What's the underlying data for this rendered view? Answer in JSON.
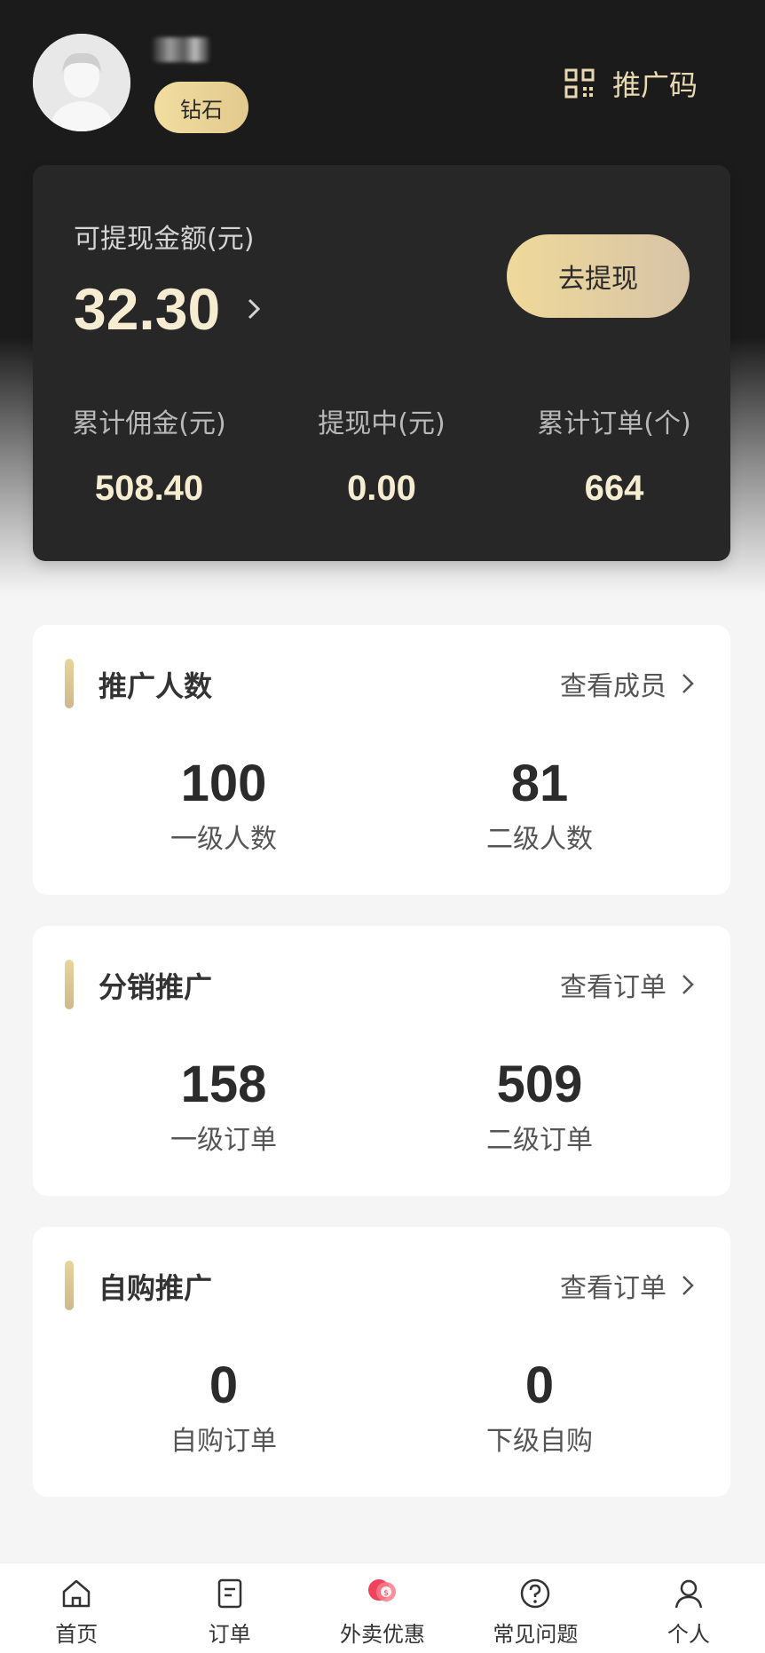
{
  "header": {
    "badge": "钻石",
    "promo_code_label": "推广码"
  },
  "wallet": {
    "label": "可提现金额(元)",
    "amount": "32.30",
    "withdraw_button": "去提现",
    "stats": [
      {
        "label": "累计佣金(元)",
        "value": "508.40"
      },
      {
        "label": "提现中(元)",
        "value": "0.00"
      },
      {
        "label": "累计订单(个)",
        "value": "664"
      }
    ]
  },
  "sections": [
    {
      "title": "推广人数",
      "link": "查看成员",
      "items": [
        {
          "value": "100",
          "label": "一级人数"
        },
        {
          "value": "81",
          "label": "二级人数"
        }
      ]
    },
    {
      "title": "分销推广",
      "link": "查看订单",
      "items": [
        {
          "value": "158",
          "label": "一级订单"
        },
        {
          "value": "509",
          "label": "二级订单"
        }
      ]
    },
    {
      "title": "自购推广",
      "link": "查看订单",
      "items": [
        {
          "value": "0",
          "label": "自购订单"
        },
        {
          "value": "0",
          "label": "下级自购"
        }
      ]
    }
  ],
  "tabbar": [
    {
      "label": "首页",
      "icon": "home-icon"
    },
    {
      "label": "订单",
      "icon": "order-icon"
    },
    {
      "label": "外卖优惠",
      "icon": "coupon-icon"
    },
    {
      "label": "常见问题",
      "icon": "question-icon"
    },
    {
      "label": "个人",
      "icon": "user-icon"
    }
  ],
  "colors": {
    "gold": "#f6ecd1",
    "gold_button": "#efd99a",
    "dark_card": "#272727",
    "accent_red": "#f0425d"
  }
}
